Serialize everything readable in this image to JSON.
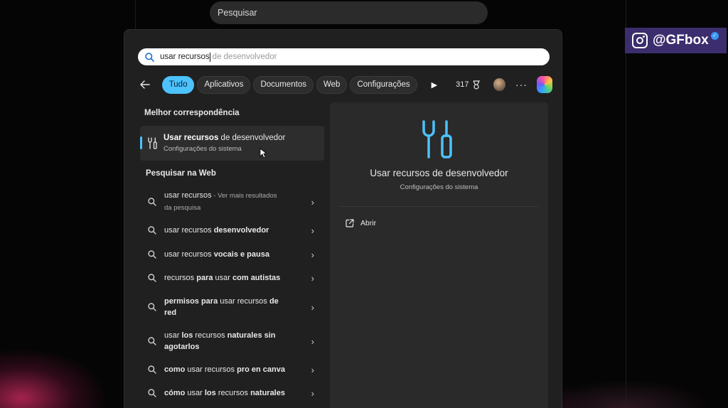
{
  "taskbar": {
    "search_label": "Pesquisar"
  },
  "badge": {
    "handle": "@GFbox"
  },
  "search": {
    "typed": "usar recursos",
    "suggestion": "de desenvolvedor"
  },
  "filters": {
    "tabs": [
      {
        "label": "Tudo",
        "active": true
      },
      {
        "label": "Aplicativos",
        "active": false
      },
      {
        "label": "Documentos",
        "active": false
      },
      {
        "label": "Web",
        "active": false
      },
      {
        "label": "Configurações",
        "active": false
      }
    ],
    "points": "317",
    "more": "···"
  },
  "best_match": {
    "section_title": "Melhor correspondência",
    "title_bold": "Usar recursos",
    "title_rest": " de desenvolvedor",
    "subtitle": "Configurações do sistema"
  },
  "web": {
    "section_title": "Pesquisar na Web",
    "items": [
      {
        "parts": [
          [
            "n",
            "usar recursos"
          ],
          [
            "d",
            " - Ver mais resultados da pesquisa"
          ]
        ]
      },
      {
        "parts": [
          [
            "n",
            "usar recursos "
          ],
          [
            "b",
            "desenvolvedor"
          ]
        ]
      },
      {
        "parts": [
          [
            "n",
            "usar recursos "
          ],
          [
            "b",
            "vocais e pausa"
          ]
        ]
      },
      {
        "parts": [
          [
            "n",
            "recursos "
          ],
          [
            "b",
            "para"
          ],
          [
            "n",
            " usar "
          ],
          [
            "b",
            "com autistas"
          ]
        ]
      },
      {
        "parts": [
          [
            "b",
            "permisos para"
          ],
          [
            "n",
            " usar recursos "
          ],
          [
            "b",
            "de red"
          ]
        ]
      },
      {
        "parts": [
          [
            "n",
            "usar "
          ],
          [
            "b",
            "los"
          ],
          [
            "n",
            " recursos "
          ],
          [
            "b",
            "naturales sin agotarlos"
          ]
        ]
      },
      {
        "parts": [
          [
            "b",
            "como"
          ],
          [
            "n",
            " usar recursos "
          ],
          [
            "b",
            "pro en canva"
          ]
        ]
      },
      {
        "parts": [
          [
            "b",
            "cómo"
          ],
          [
            "n",
            " usar "
          ],
          [
            "b",
            "los"
          ],
          [
            "n",
            " recursos "
          ],
          [
            "b",
            "naturales"
          ]
        ]
      }
    ]
  },
  "preview": {
    "title": "Usar recursos de desenvolvedor",
    "subtitle": "Configurações do sistema",
    "open_label": "Abrir"
  },
  "colors": {
    "accent": "#4cc2ff",
    "panel": "#202020",
    "preview_panel": "#2a2a2a",
    "badge": "#3c2d6e"
  }
}
